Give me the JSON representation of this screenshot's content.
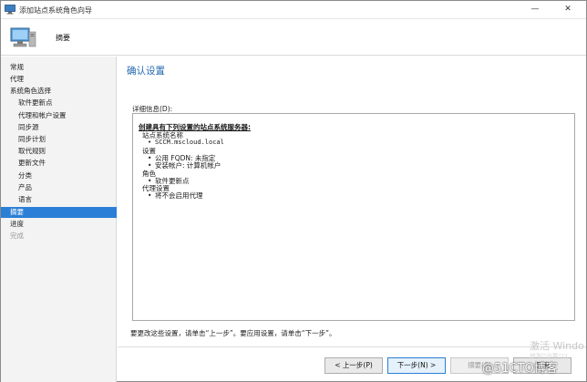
{
  "window": {
    "title": "添加站点系统角色向导",
    "minimize_glyph": "—",
    "close_glyph": "✕"
  },
  "header": {
    "title": "摘要",
    "icon": "computer-monitor-icon"
  },
  "nav": {
    "items": [
      {
        "label": "常规",
        "state": "normal"
      },
      {
        "label": "代理",
        "state": "normal"
      },
      {
        "label": "系统角色选择",
        "state": "normal"
      },
      {
        "label": "软件更新点",
        "state": "normal"
      },
      {
        "label": "代理和帐户设置",
        "state": "normal"
      },
      {
        "label": "同步源",
        "state": "normal"
      },
      {
        "label": "同步计划",
        "state": "normal"
      },
      {
        "label": "取代规则",
        "state": "normal"
      },
      {
        "label": "更新文件",
        "state": "normal"
      },
      {
        "label": "分类",
        "state": "normal"
      },
      {
        "label": "产品",
        "state": "normal"
      },
      {
        "label": "语言",
        "state": "normal"
      },
      {
        "label": "摘要",
        "state": "active"
      },
      {
        "label": "进度",
        "state": "normal"
      },
      {
        "label": "完成",
        "state": "disabled"
      }
    ]
  },
  "main": {
    "page_title": "确认设置",
    "details_label": "详细信息(D):",
    "details": {
      "heading": "创建具有下列设置的站点系统服务器:",
      "lines": [
        "站点系统名称",
        "SCCM.mscloud.local",
        "设置",
        "公用 FQDN: 未指定",
        "安装帐户: 计算机帐户",
        "角色",
        "软件更新点",
        "代理设置",
        "将不会启用代理"
      ]
    },
    "footer_note": "要更改这些设置，请单击“上一步”。要应用设置，请单击“下一步”。"
  },
  "buttons": {
    "prev": "< 上一步(P)",
    "next": "下一步(N) >",
    "summary": "摘要(S)",
    "cancel": "取消"
  },
  "watermark": {
    "activate": "激活 Windo",
    "activate_sub": "转到“设置”以",
    "blog": "@51CTO博客"
  },
  "colors": {
    "accent": "#2b7fd6",
    "page_title": "#2468b0",
    "nav_bg": "#f3f3f3"
  }
}
